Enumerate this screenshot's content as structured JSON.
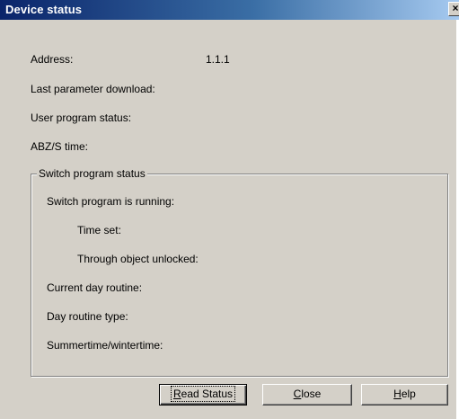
{
  "window": {
    "title": "Device status",
    "close_glyph": "×"
  },
  "fields": {
    "address_label": "Address:",
    "address_value": "1.1.1",
    "last_param_label": "Last parameter download:",
    "user_program_label": "User program status:",
    "abzs_label": "ABZ/S time:"
  },
  "group": {
    "legend": "Switch program status",
    "running_label": "Switch program is running:",
    "time_set_label": "Time set:",
    "through_object_label": "Through object unlocked:",
    "current_day_label": "Current day routine:",
    "day_type_label": "Day routine type:",
    "summer_label": "Summertime/wintertime:"
  },
  "buttons": {
    "read_status": {
      "accel": "R",
      "rest": "ead Status"
    },
    "close": {
      "accel": "C",
      "rest": "lose"
    },
    "help": {
      "accel": "H",
      "rest": "elp"
    }
  },
  "icons": {
    "close": "close-icon"
  }
}
